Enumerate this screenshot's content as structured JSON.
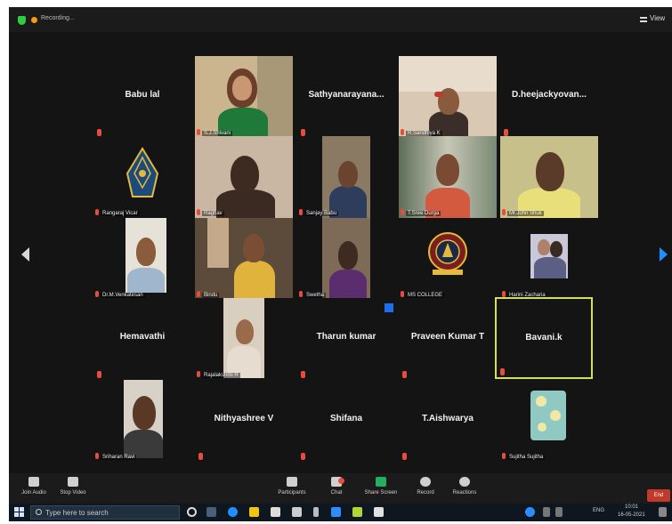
{
  "topbar": {
    "recording_label": "Recording...",
    "view_label": "View"
  },
  "participants_named": [
    {
      "id": "babu",
      "name": "Babu lal"
    },
    {
      "id": "sathya",
      "name": "Sathyanarayana..."
    },
    {
      "id": "dheeja",
      "name": "D.heejackyovan..."
    },
    {
      "id": "hema",
      "name": "Hemavathi"
    },
    {
      "id": "tharun",
      "name": "Tharun kumar"
    },
    {
      "id": "praveen",
      "name": "Praveen Kumar T"
    },
    {
      "id": "bavani",
      "name": "Bavani.k"
    },
    {
      "id": "nithya",
      "name": "Nithyashree V"
    },
    {
      "id": "shifana",
      "name": "Shifana"
    },
    {
      "id": "aishwarya",
      "name": "T.Aishwarya"
    }
  ],
  "video_captions": {
    "v1": "S.J.Shivani",
    "v2": "R.Sandhiya K",
    "v3": "Rangaraj Vicar",
    "v4": "Raghav",
    "v5": "Sanjay Babu",
    "v6": "T.Sree Durga",
    "v7": "Mr.John Shuk",
    "v8": "Dr.M.Venkatesan",
    "v9": "Bindu",
    "v10": "Swetha",
    "v11": "MS COLLEGE",
    "v12": "Harini Zacharia",
    "v13": "Rajalakshmi R",
    "v14": "Sriharan Ravi",
    "v15": "Sujitha Sujitha"
  },
  "toolbar": {
    "join_audio": "Join Audio",
    "stop_video": "Stop Video",
    "participants": "Participants",
    "chat": "Chat",
    "share_screen": "Share Screen",
    "record": "Record",
    "reactions": "Reactions",
    "end": "End"
  },
  "taskbar": {
    "search_placeholder": "Type here to search",
    "lang": "ENG",
    "time": "10:01",
    "date": "16-05-2021"
  },
  "colors": {
    "active_speaker_border": "#d4e157",
    "background": "#141414",
    "mic_muted": "#e74c3c"
  }
}
